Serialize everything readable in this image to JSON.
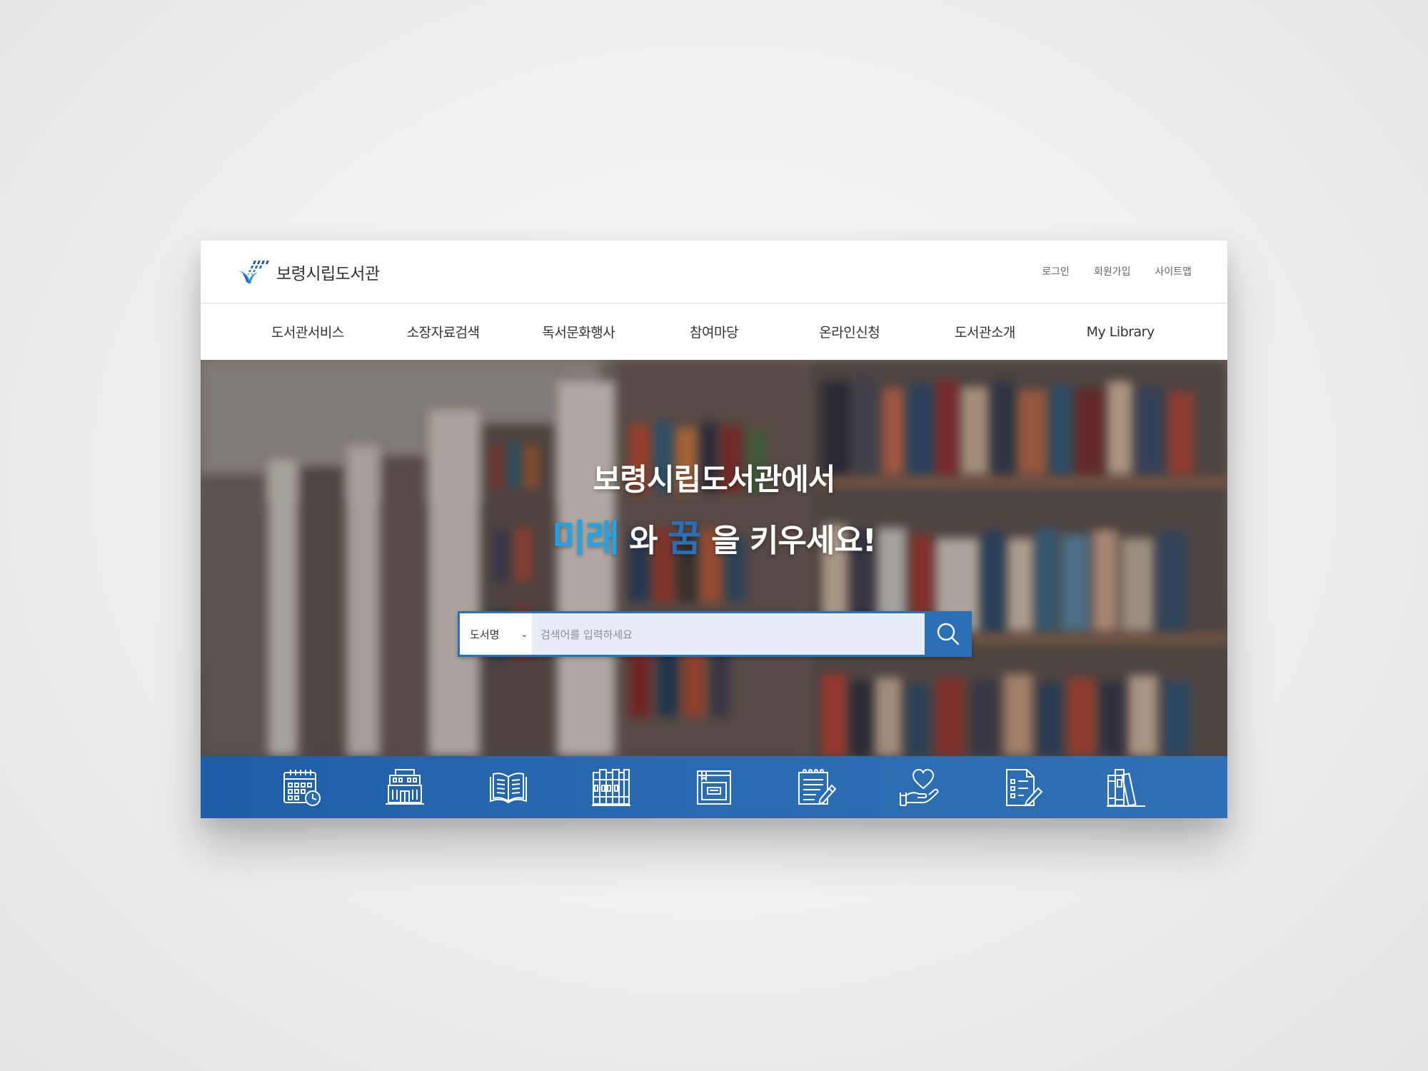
{
  "site": {
    "name": "보령시립도서관"
  },
  "utility": {
    "login": "로그인",
    "join": "회원가입",
    "sitemap": "사이트맵"
  },
  "nav": {
    "items": [
      "도서관서비스",
      "소장자료검색",
      "독서문화행사",
      "참여마당",
      "온라인신청",
      "도서관소개",
      "My Library"
    ]
  },
  "hero": {
    "title": "보령시립도서관에서",
    "sub_word1": "미래",
    "sub_mid1": " 와 ",
    "sub_word2": "꿈",
    "sub_end": " 을 키우세요!"
  },
  "search": {
    "category": "도서명",
    "placeholder": "검색어를 입력하세요"
  },
  "quick_icons": [
    "calendar-clock-icon",
    "library-building-icon",
    "open-book-icon",
    "bookshelf-icon",
    "book-cover-icon",
    "notepad-pencil-icon",
    "heart-hand-icon",
    "checklist-pencil-icon",
    "books-stack-icon"
  ],
  "colors": {
    "accent_blue": "#2b6fb6",
    "accent_light_blue": "#21a3e6",
    "quick_bar": "#2a6cb3"
  }
}
